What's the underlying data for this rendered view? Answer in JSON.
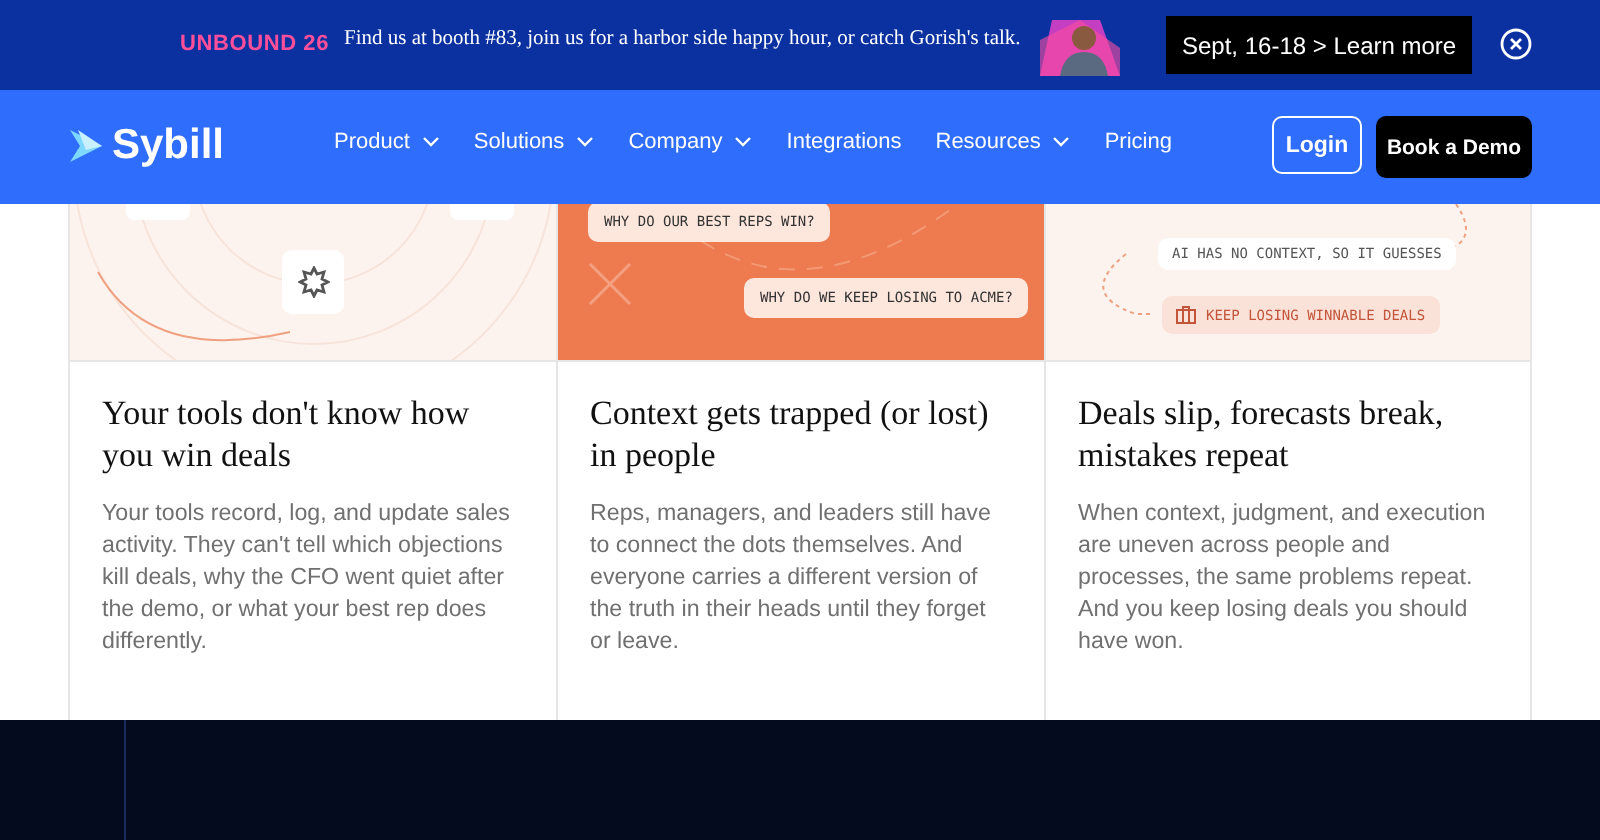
{
  "banner": {
    "event": "UNBOUND 26",
    "message": "Find us at booth #83, join us for a harbor side happy hour, or catch Gorish's talk.",
    "cta": "Sept, 16-18 > Learn more"
  },
  "nav": {
    "logo": "Sybill",
    "items": [
      {
        "label": "Product",
        "dropdown": true
      },
      {
        "label": "Solutions",
        "dropdown": true
      },
      {
        "label": "Company",
        "dropdown": true
      },
      {
        "label": "Integrations",
        "dropdown": false
      },
      {
        "label": "Resources",
        "dropdown": true
      },
      {
        "label": "Pricing",
        "dropdown": false
      }
    ],
    "login": "Login",
    "demo": "Book a Demo"
  },
  "cards": [
    {
      "kind": "badge",
      "title": "Your tools don't know how you win deals",
      "body": "Your tools record, log, and update sales activity. They can't tell which objections kill deals, why the CFO went quiet after the demo, or what your best rep does differently."
    },
    {
      "kind": "questions",
      "bubbles": [
        "WHY DO OUR BEST REPS WIN?",
        "WHY DO WE KEEP LOSING TO ACME?"
      ],
      "title": "Context gets trapped (or lost) in people",
      "body": "Reps, managers, and leaders still have to connect the dots themselves. And everyone carries a different version of the truth in their heads until they forget or leave."
    },
    {
      "kind": "flow",
      "bubbles": [
        "AI HAS NO CONTEXT, SO IT GUESSES",
        "KEEP LOSING WINNABLE DEALS"
      ],
      "title": "Deals slip, forecasts break, mistakes repeat",
      "body": "When context, judgment, and execution are uneven across people and processes, the same problems repeat. And you keep losing deals you should have won."
    }
  ]
}
